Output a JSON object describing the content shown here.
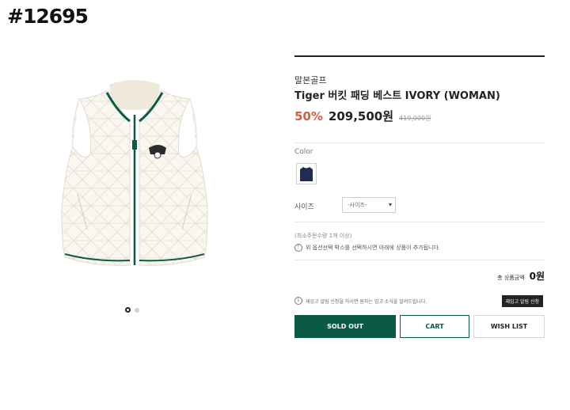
{
  "page_id": "#12695",
  "product": {
    "brand": "말본골프",
    "title": "Tiger 버킷 패딩 베스트 IVORY (WOMAN)",
    "discount": "50%",
    "price": "209,500원",
    "original_price": "419,000원"
  },
  "options": {
    "color_label": "Color",
    "color_swatch": "#1f2d52",
    "size_label": "사이즈",
    "size_select_value": "-사이즈-",
    "min_qty": "(최소주문수량 1개 이상)",
    "notice": "위 옵션선택 박스를 선택하시면 아래에 상품이 추가됩니다."
  },
  "total": {
    "label": "총 상품금액",
    "value": "0원"
  },
  "restock": {
    "note": "재입고 알림 신청을 하시면 원하는 입고 소식을 알려드립니다.",
    "button": "재입고 알림 신청"
  },
  "actions": {
    "sold_out": "SOLD OUT",
    "cart": "CART",
    "wish_list": "WISH LIST"
  },
  "colors": {
    "accent_green": "#0b5a45",
    "discount_red": "#e15a3a"
  },
  "gallery": {
    "image": "ivory quilted padded vest with green trim",
    "dots": 2,
    "active_dot": 1
  }
}
